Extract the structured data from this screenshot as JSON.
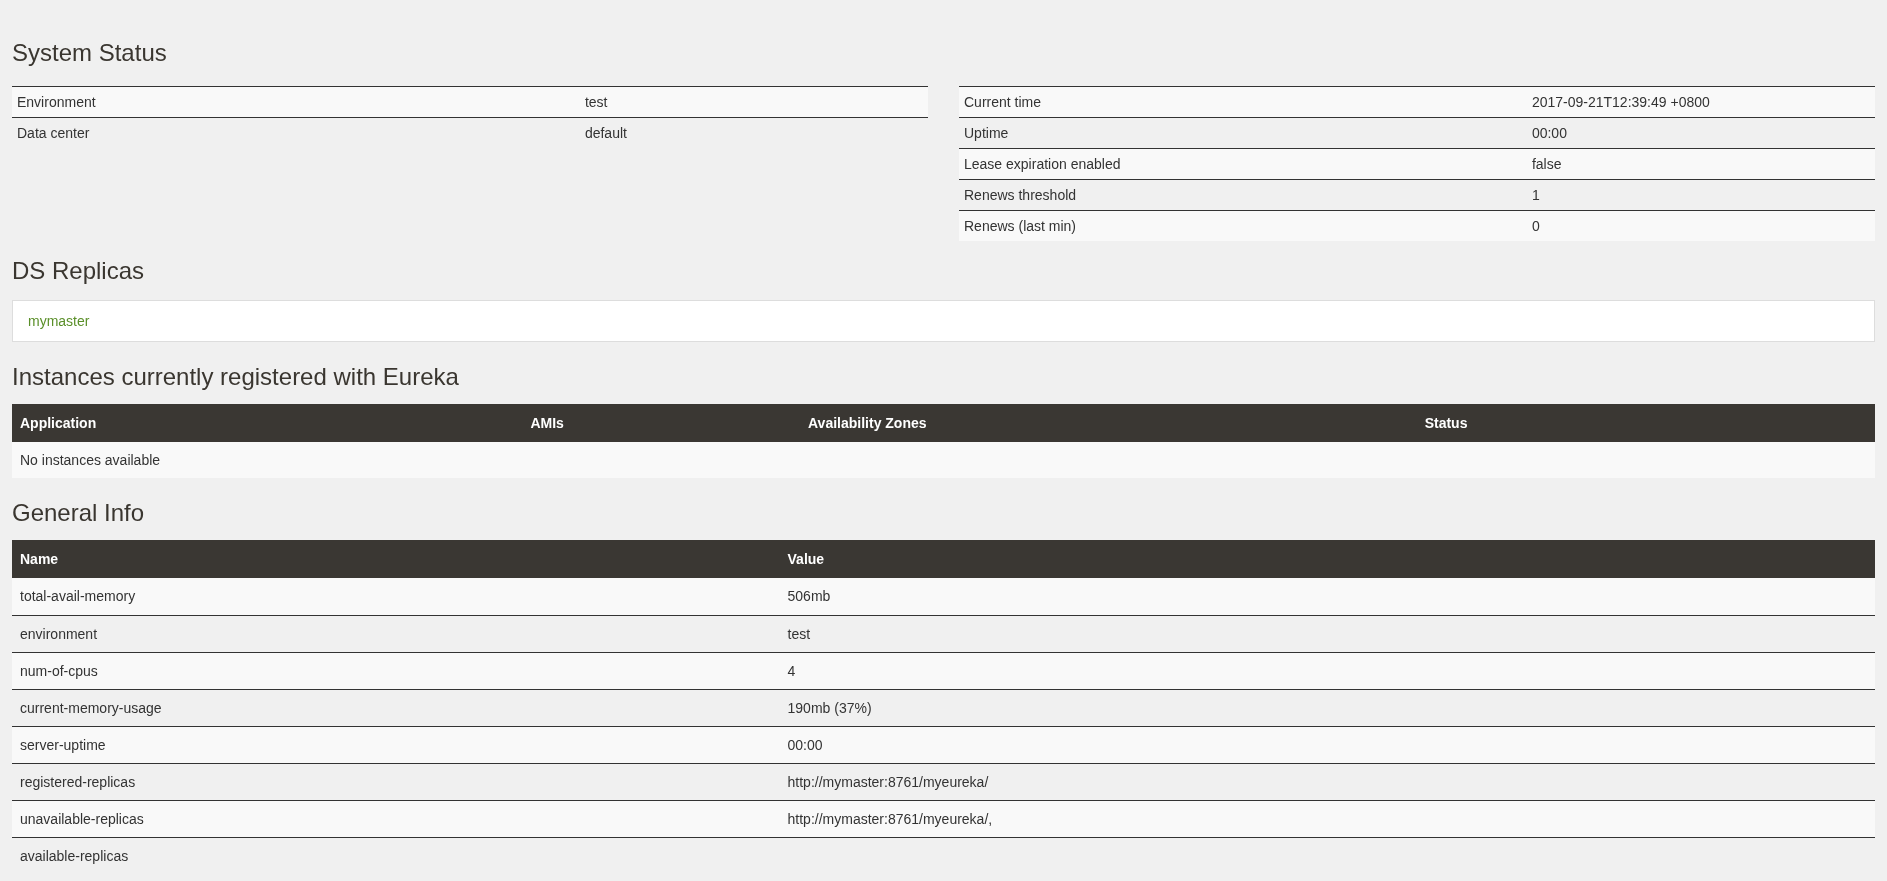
{
  "system_status": {
    "title": "System Status",
    "left_rows": [
      {
        "label": "Environment",
        "value": "test"
      },
      {
        "label": "Data center",
        "value": "default"
      }
    ],
    "right_rows": [
      {
        "label": "Current time",
        "value": "2017-09-21T12:39:49 +0800"
      },
      {
        "label": "Uptime",
        "value": "00:00"
      },
      {
        "label": "Lease expiration enabled",
        "value": "false"
      },
      {
        "label": "Renews threshold",
        "value": "1"
      },
      {
        "label": "Renews (last min)",
        "value": "0"
      }
    ]
  },
  "ds_replicas": {
    "title": "DS Replicas",
    "items": [
      "mymaster"
    ]
  },
  "instances": {
    "title": "Instances currently registered with Eureka",
    "columns": [
      "Application",
      "AMIs",
      "Availability Zones",
      "Status"
    ],
    "empty_message": "No instances available"
  },
  "general_info": {
    "title": "General Info",
    "columns": [
      "Name",
      "Value"
    ],
    "rows": [
      {
        "name": "total-avail-memory",
        "value": "506mb"
      },
      {
        "name": "environment",
        "value": "test"
      },
      {
        "name": "num-of-cpus",
        "value": "4"
      },
      {
        "name": "current-memory-usage",
        "value": "190mb (37%)"
      },
      {
        "name": "server-uptime",
        "value": "00:00"
      },
      {
        "name": "registered-replicas",
        "value": "http://mymaster:8761/myeureka/"
      },
      {
        "name": "unavailable-replicas",
        "value": "http://mymaster:8761/myeureka/,"
      },
      {
        "name": "available-replicas",
        "value": ""
      }
    ]
  }
}
